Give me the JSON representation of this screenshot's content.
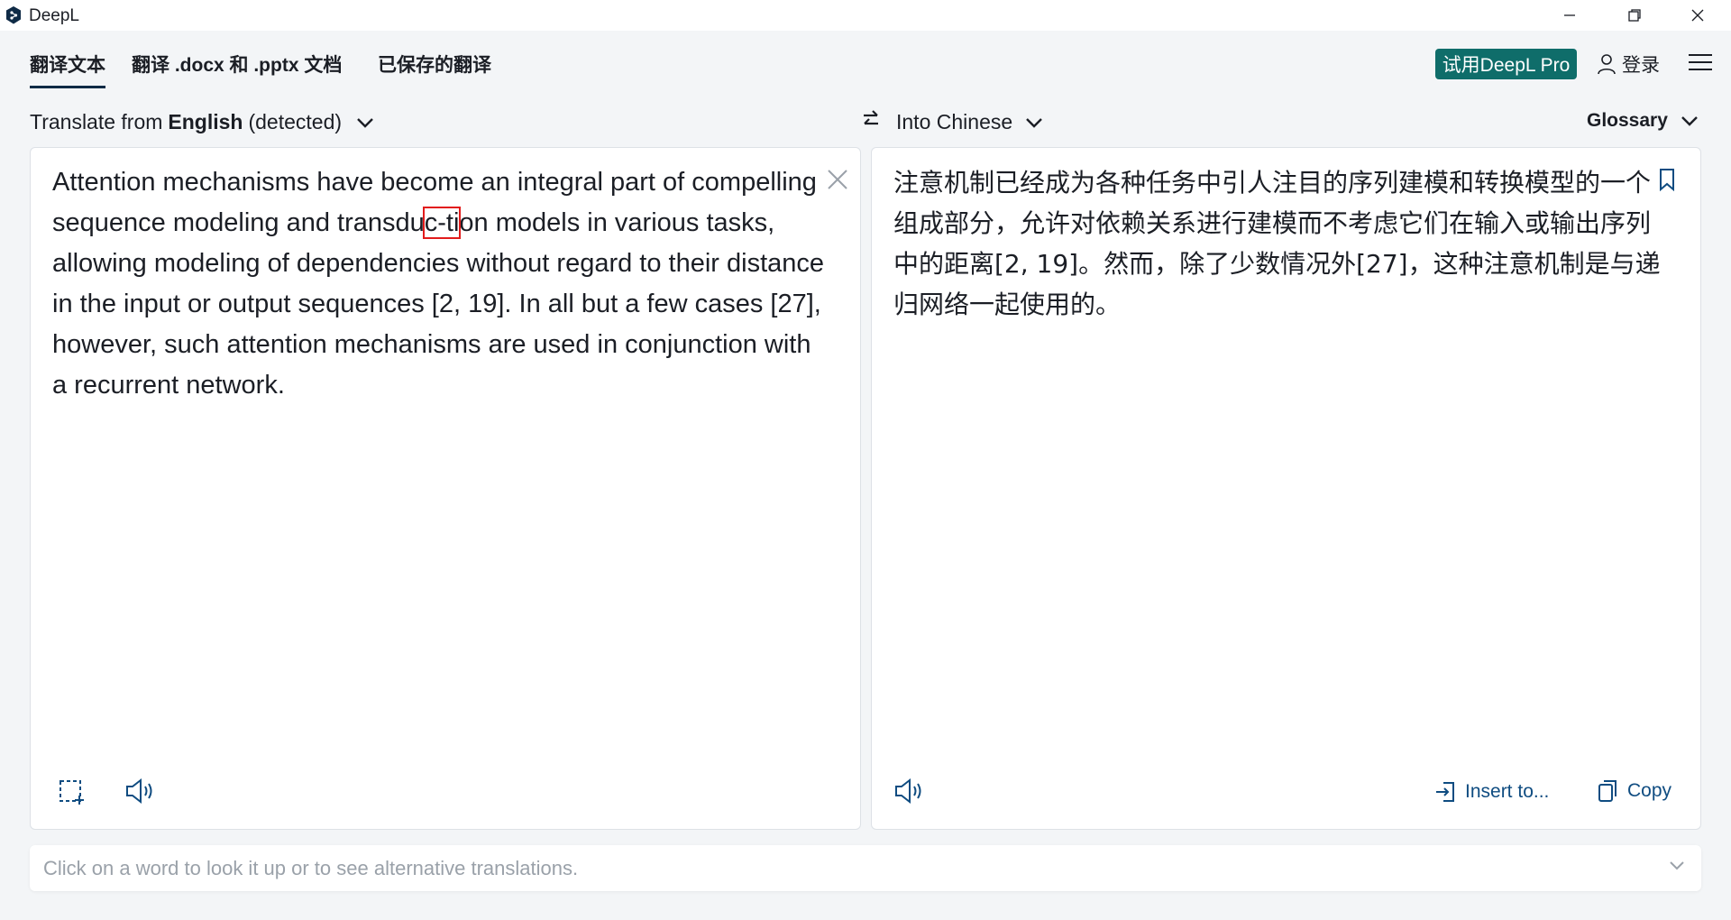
{
  "window": {
    "title": "DeepL",
    "colors": {
      "accent": "#0f2b46",
      "pro_button": "#0f6d6a",
      "link": "#0f4c81",
      "highlight_box": "#e21b1b"
    }
  },
  "nav": {
    "tabs": [
      {
        "label": "翻译文本",
        "active": true
      },
      {
        "label": "翻译 .docx 和 .pptx 文档",
        "active": false
      },
      {
        "label": "已保存的翻译",
        "active": false
      }
    ],
    "pro_button": "试用DeepL Pro",
    "login": "登录",
    "menu_icon": "hamburger-menu-icon"
  },
  "langbar": {
    "from_prefix": "Translate from",
    "from_lang": "English",
    "from_suffix": "(detected)",
    "to_prefix": "Into",
    "to_lang": "Chinese",
    "glossary": "Glossary"
  },
  "source": {
    "before": "Attention mechanisms have become an integral part of compelling sequence modeling and transdu",
    "highlighted": "c-ti",
    "after": "on models in various tasks, allowing modeling of dependencies without regard to their distance in the input or output sequences [2, 19]. In all but a few cases [27], however, such attention mechanisms are used in conjunction with a recurrent network."
  },
  "target": {
    "text": "注意机制已经成为各种任务中引人注目的序列建模和转换模型的一个组成部分，允许对依赖关系进行建模而不考虑它们在输入或输出序列中的距离[2, 19]。然而，除了少数情况外[27]，这种注意机制是与递归网络一起使用的。",
    "insert_label": "Insert to...",
    "copy_label": "Copy"
  },
  "hint": {
    "text": "Click on a word to look it up or to see alternative translations."
  }
}
